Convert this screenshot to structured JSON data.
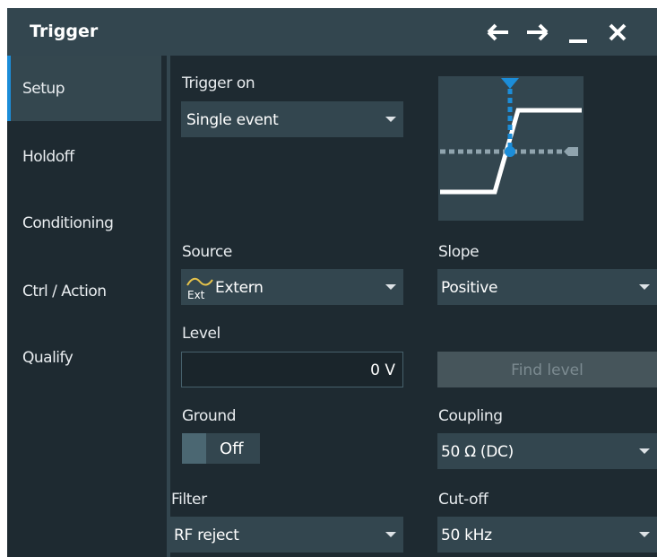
{
  "window": {
    "title": "Trigger",
    "icons": [
      "back-arrow-icon",
      "forward-arrow-icon",
      "minimize-icon",
      "close-icon"
    ]
  },
  "sidebar": {
    "items": [
      {
        "label": "Setup",
        "active": true
      },
      {
        "label": "Holdoff",
        "active": false
      },
      {
        "label": "Conditioning",
        "active": false
      },
      {
        "label": "Ctrl / Action",
        "active": false
      },
      {
        "label": "Qualify",
        "active": false
      }
    ]
  },
  "trigger_on": {
    "label": "Trigger on",
    "value": "Single event"
  },
  "source": {
    "label": "Source",
    "value": "Extern",
    "icon_text": "Ext"
  },
  "slope": {
    "label": "Slope",
    "value": "Positive"
  },
  "level": {
    "label": "Level",
    "value": "0 V"
  },
  "find_level": {
    "label": "Find level"
  },
  "ground": {
    "label": "Ground",
    "value": "Off"
  },
  "coupling": {
    "label": "Coupling",
    "value": "50 Ω (DC)"
  },
  "filter": {
    "label": "Filter",
    "value": "RF reject"
  },
  "cutoff": {
    "label": "Cut-off",
    "value": "50 kHz"
  },
  "colors": {
    "accent": "#1c8dd8",
    "panel": "#1e2a31",
    "field": "#33464f"
  }
}
